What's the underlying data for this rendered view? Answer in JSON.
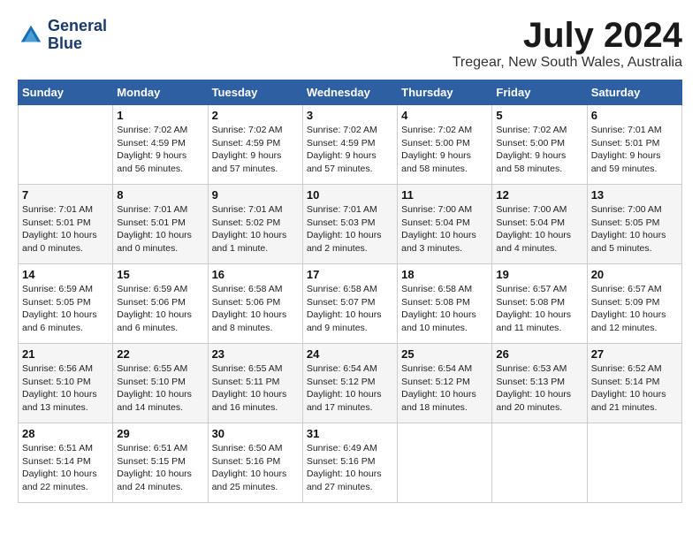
{
  "header": {
    "logo_line1": "General",
    "logo_line2": "Blue",
    "month_year": "July 2024",
    "location": "Tregear, New South Wales, Australia"
  },
  "weekdays": [
    "Sunday",
    "Monday",
    "Tuesday",
    "Wednesday",
    "Thursday",
    "Friday",
    "Saturday"
  ],
  "weeks": [
    [
      {
        "day": "",
        "sunrise": "",
        "sunset": "",
        "daylight": ""
      },
      {
        "day": "1",
        "sunrise": "Sunrise: 7:02 AM",
        "sunset": "Sunset: 4:59 PM",
        "daylight": "Daylight: 9 hours and 56 minutes."
      },
      {
        "day": "2",
        "sunrise": "Sunrise: 7:02 AM",
        "sunset": "Sunset: 4:59 PM",
        "daylight": "Daylight: 9 hours and 57 minutes."
      },
      {
        "day": "3",
        "sunrise": "Sunrise: 7:02 AM",
        "sunset": "Sunset: 4:59 PM",
        "daylight": "Daylight: 9 hours and 57 minutes."
      },
      {
        "day": "4",
        "sunrise": "Sunrise: 7:02 AM",
        "sunset": "Sunset: 5:00 PM",
        "daylight": "Daylight: 9 hours and 58 minutes."
      },
      {
        "day": "5",
        "sunrise": "Sunrise: 7:02 AM",
        "sunset": "Sunset: 5:00 PM",
        "daylight": "Daylight: 9 hours and 58 minutes."
      },
      {
        "day": "6",
        "sunrise": "Sunrise: 7:01 AM",
        "sunset": "Sunset: 5:01 PM",
        "daylight": "Daylight: 9 hours and 59 minutes."
      }
    ],
    [
      {
        "day": "7",
        "sunrise": "Sunrise: 7:01 AM",
        "sunset": "Sunset: 5:01 PM",
        "daylight": "Daylight: 10 hours and 0 minutes."
      },
      {
        "day": "8",
        "sunrise": "Sunrise: 7:01 AM",
        "sunset": "Sunset: 5:01 PM",
        "daylight": "Daylight: 10 hours and 0 minutes."
      },
      {
        "day": "9",
        "sunrise": "Sunrise: 7:01 AM",
        "sunset": "Sunset: 5:02 PM",
        "daylight": "Daylight: 10 hours and 1 minute."
      },
      {
        "day": "10",
        "sunrise": "Sunrise: 7:01 AM",
        "sunset": "Sunset: 5:03 PM",
        "daylight": "Daylight: 10 hours and 2 minutes."
      },
      {
        "day": "11",
        "sunrise": "Sunrise: 7:00 AM",
        "sunset": "Sunset: 5:04 PM",
        "daylight": "Daylight: 10 hours and 3 minutes."
      },
      {
        "day": "12",
        "sunrise": "Sunrise: 7:00 AM",
        "sunset": "Sunset: 5:04 PM",
        "daylight": "Daylight: 10 hours and 4 minutes."
      },
      {
        "day": "13",
        "sunrise": "Sunrise: 7:00 AM",
        "sunset": "Sunset: 5:05 PM",
        "daylight": "Daylight: 10 hours and 5 minutes."
      }
    ],
    [
      {
        "day": "14",
        "sunrise": "Sunrise: 6:59 AM",
        "sunset": "Sunset: 5:05 PM",
        "daylight": "Daylight: 10 hours and 6 minutes."
      },
      {
        "day": "15",
        "sunrise": "Sunrise: 6:59 AM",
        "sunset": "Sunset: 5:06 PM",
        "daylight": "Daylight: 10 hours and 6 minutes."
      },
      {
        "day": "16",
        "sunrise": "Sunrise: 6:58 AM",
        "sunset": "Sunset: 5:06 PM",
        "daylight": "Daylight: 10 hours and 8 minutes."
      },
      {
        "day": "17",
        "sunrise": "Sunrise: 6:58 AM",
        "sunset": "Sunset: 5:07 PM",
        "daylight": "Daylight: 10 hours and 9 minutes."
      },
      {
        "day": "18",
        "sunrise": "Sunrise: 6:58 AM",
        "sunset": "Sunset: 5:08 PM",
        "daylight": "Daylight: 10 hours and 10 minutes."
      },
      {
        "day": "19",
        "sunrise": "Sunrise: 6:57 AM",
        "sunset": "Sunset: 5:08 PM",
        "daylight": "Daylight: 10 hours and 11 minutes."
      },
      {
        "day": "20",
        "sunrise": "Sunrise: 6:57 AM",
        "sunset": "Sunset: 5:09 PM",
        "daylight": "Daylight: 10 hours and 12 minutes."
      }
    ],
    [
      {
        "day": "21",
        "sunrise": "Sunrise: 6:56 AM",
        "sunset": "Sunset: 5:10 PM",
        "daylight": "Daylight: 10 hours and 13 minutes."
      },
      {
        "day": "22",
        "sunrise": "Sunrise: 6:55 AM",
        "sunset": "Sunset: 5:10 PM",
        "daylight": "Daylight: 10 hours and 14 minutes."
      },
      {
        "day": "23",
        "sunrise": "Sunrise: 6:55 AM",
        "sunset": "Sunset: 5:11 PM",
        "daylight": "Daylight: 10 hours and 16 minutes."
      },
      {
        "day": "24",
        "sunrise": "Sunrise: 6:54 AM",
        "sunset": "Sunset: 5:12 PM",
        "daylight": "Daylight: 10 hours and 17 minutes."
      },
      {
        "day": "25",
        "sunrise": "Sunrise: 6:54 AM",
        "sunset": "Sunset: 5:12 PM",
        "daylight": "Daylight: 10 hours and 18 minutes."
      },
      {
        "day": "26",
        "sunrise": "Sunrise: 6:53 AM",
        "sunset": "Sunset: 5:13 PM",
        "daylight": "Daylight: 10 hours and 20 minutes."
      },
      {
        "day": "27",
        "sunrise": "Sunrise: 6:52 AM",
        "sunset": "Sunset: 5:14 PM",
        "daylight": "Daylight: 10 hours and 21 minutes."
      }
    ],
    [
      {
        "day": "28",
        "sunrise": "Sunrise: 6:51 AM",
        "sunset": "Sunset: 5:14 PM",
        "daylight": "Daylight: 10 hours and 22 minutes."
      },
      {
        "day": "29",
        "sunrise": "Sunrise: 6:51 AM",
        "sunset": "Sunset: 5:15 PM",
        "daylight": "Daylight: 10 hours and 24 minutes."
      },
      {
        "day": "30",
        "sunrise": "Sunrise: 6:50 AM",
        "sunset": "Sunset: 5:16 PM",
        "daylight": "Daylight: 10 hours and 25 minutes."
      },
      {
        "day": "31",
        "sunrise": "Sunrise: 6:49 AM",
        "sunset": "Sunset: 5:16 PM",
        "daylight": "Daylight: 10 hours and 27 minutes."
      },
      {
        "day": "",
        "sunrise": "",
        "sunset": "",
        "daylight": ""
      },
      {
        "day": "",
        "sunrise": "",
        "sunset": "",
        "daylight": ""
      },
      {
        "day": "",
        "sunrise": "",
        "sunset": "",
        "daylight": ""
      }
    ]
  ]
}
